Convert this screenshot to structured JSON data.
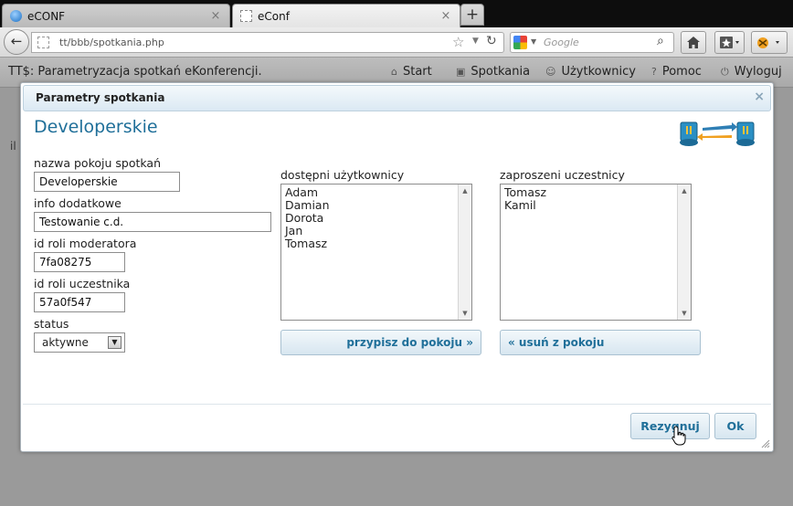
{
  "browser": {
    "tabs": [
      {
        "title": "eCONF",
        "close": "×",
        "active": false
      },
      {
        "title": "eConf",
        "close": "×",
        "active": true
      }
    ],
    "new_tab": "+",
    "url": "tt/bbb/spotkania.php",
    "search": {
      "engine": "Google",
      "placeholder": "Google"
    }
  },
  "app": {
    "title": "TT$: Parametryzacja spotkań eKonferencji.",
    "menu": [
      {
        "label": "Start",
        "icon": "home-icon"
      },
      {
        "label": "Spotkania",
        "icon": "meetings-icon"
      },
      {
        "label": "Użytkownicy",
        "icon": "user-icon"
      },
      {
        "label": "Pomoc",
        "icon": "help-icon"
      },
      {
        "label": "Wyloguj",
        "icon": "power-icon"
      }
    ],
    "background_text": "il"
  },
  "dialog": {
    "title": "Parametry spotkania",
    "close": "×",
    "heading": "Developerskie",
    "fields": {
      "room_name": {
        "label": "nazwa pokoju spotkań",
        "value": "Developerskie"
      },
      "info": {
        "label": "info dodatkowe",
        "value": "Testowanie c.d."
      },
      "moderator_role": {
        "label": "id roli moderatora",
        "value": "7fa08275"
      },
      "participant_role": {
        "label": "id roli uczestnika",
        "value": "57a0f547"
      },
      "status": {
        "label": "status",
        "value": "aktywne"
      }
    },
    "available_users": {
      "label": "dostępni użytkownicy",
      "items": [
        "Adam",
        "Damian",
        "Dorota",
        "Jan",
        "Tomasz"
      ]
    },
    "invited": {
      "label": "zaproszeni uczestnicy",
      "items": [
        "Tomasz",
        "Kamil"
      ]
    },
    "assign_button": "przypisz do pokoju »",
    "remove_button": "« usuń z pokoju",
    "cancel_button": "Rezygnuj",
    "ok_button": "Ok"
  },
  "colors": {
    "accent": "#1f6f99",
    "dialog_header": "#dbe9f3",
    "button_border": "#a9c1d1"
  }
}
